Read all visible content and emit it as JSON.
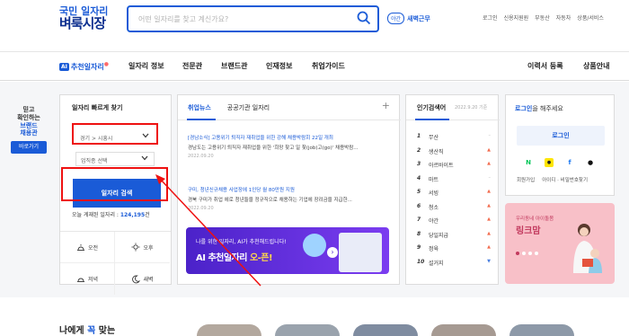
{
  "header": {
    "logo_line1": "국민 일자리",
    "logo_line2": "벼룩시장",
    "search_placeholder": "어떤 일자리를 찾고 계신가요?",
    "night_badge": "야간",
    "night_label": "새벽근무",
    "util_links": [
      "로그인",
      "신용지원원",
      "부동산",
      "자동차",
      "상품/서비스"
    ]
  },
  "gnb": {
    "ai_badge": "AI",
    "ai_label": "추천일자리",
    "items": [
      "일자리 정보",
      "전문관",
      "브랜드관",
      "인재정보",
      "취업가이드"
    ],
    "resume": "이력서 등록",
    "product": "상품안내"
  },
  "left_ad": {
    "line1": "믿고",
    "line2": "확인하는",
    "line3": "브랜드",
    "line4": "채용관",
    "button": "바로가기"
  },
  "quick": {
    "title": "일자리 빠르게 찾기",
    "region": "경기 > 시흥시",
    "job_select": "업직종 선택",
    "search_button": "일자리 검색",
    "count_label": "오늘 게재된 일자리 :",
    "count_value": "124,195",
    "count_unit": "건",
    "times": [
      "오전",
      "오후",
      "저녁",
      "새벽"
    ]
  },
  "news": {
    "tab_active": "취업뉴스",
    "tab_other": "공공기관 일자리",
    "plus": "+",
    "articles": [
      {
        "headline": "[경남소식] 고용위기 퇴직자 재취업을 위한 강해 채용박람회 22일 개최",
        "desc": "경남도는 고용위기 퇴직자 재취업을 위한 '희망 찾고 일 찾(job)고(go)' 채용박람...",
        "date": "2022.09.20"
      },
      {
        "headline": "구미, 청년신규채용 사업장에 1인당 월 80만원 지원",
        "desc": "경북 구미가 취업 에로 청년들을 정규직으로 채용하는 기업에 장려금을 지급한...",
        "date": "2022.09.20"
      }
    ],
    "banner_line1": "나를 위한 일자리, AI가 추천해드립니다!",
    "banner_line2a": "AI 추천일자리",
    "banner_line2b": "오-픈!"
  },
  "rank": {
    "title": "인기검색어",
    "date": "2022.9.20 기준",
    "items": [
      {
        "n": "1",
        "t": "무산",
        "m": "–",
        "c": "eq"
      },
      {
        "n": "2",
        "t": "생산직",
        "m": "▲",
        "c": "up"
      },
      {
        "n": "3",
        "t": "아르바이트",
        "m": "▲",
        "c": "up"
      },
      {
        "n": "4",
        "t": "마트",
        "m": "–",
        "c": "eq"
      },
      {
        "n": "5",
        "t": "서빙",
        "m": "▲",
        "c": "up"
      },
      {
        "n": "6",
        "t": "청소",
        "m": "▲",
        "c": "up"
      },
      {
        "n": "7",
        "t": "야간",
        "m": "▲",
        "c": "up"
      },
      {
        "n": "8",
        "t": "당일지급",
        "m": "▲",
        "c": "up"
      },
      {
        "n": "9",
        "t": "정육",
        "m": "▲",
        "c": "up"
      },
      {
        "n": "10",
        "t": "설거지",
        "m": "▼",
        "c": "dn"
      }
    ]
  },
  "login": {
    "title_bold": "로그인",
    "title_rest": "을 해주세요",
    "button": "로그인",
    "links": [
      "회원가입",
      "아이디 · 비밀번호찾기"
    ]
  },
  "ad": {
    "line1": "우리동네 아이돌봄",
    "line2": "링크맘"
  },
  "bottom": {
    "title_a": "나에게 ",
    "title_b": "꼭",
    "title_c": " 맞는"
  },
  "colors": {
    "brand": "#1a5bd7",
    "highlight": "#e11111"
  }
}
